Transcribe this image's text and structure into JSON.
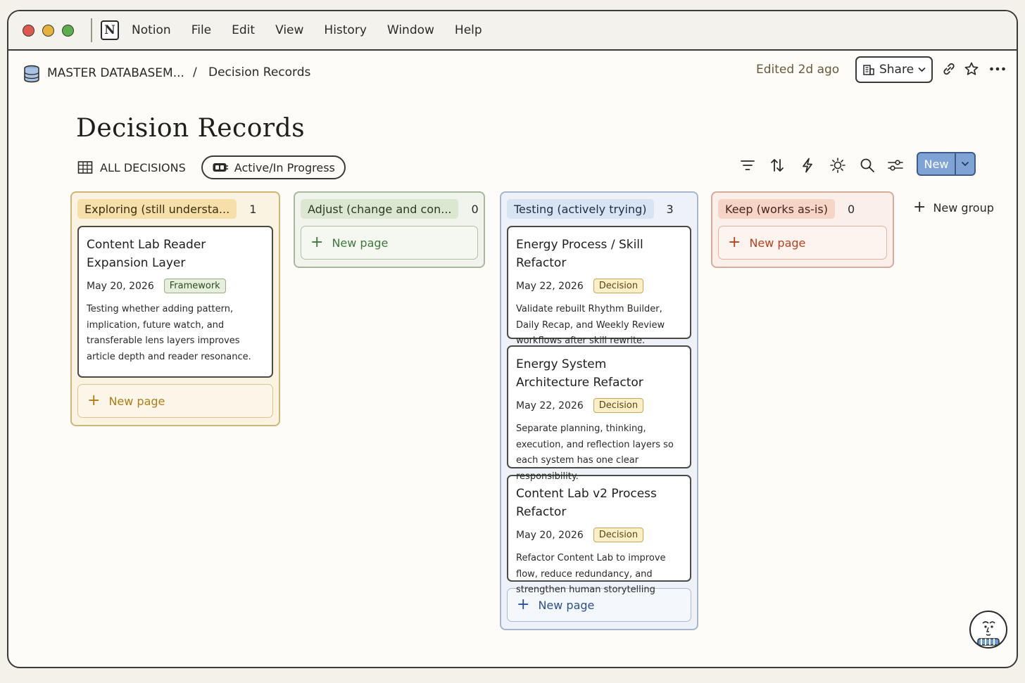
{
  "menubar": {
    "traffic_colors": [
      "#e0574f",
      "#e6b23a",
      "#5bb04d"
    ],
    "app_name": "Notion",
    "items": [
      "File",
      "Edit",
      "View",
      "History",
      "Window",
      "Help"
    ]
  },
  "breadcrumb": {
    "database": "MASTER DATABASEM...",
    "separator": "/",
    "page": "Decision Records"
  },
  "topbar": {
    "edited": "Edited 2d ago",
    "share_label": "Share"
  },
  "page": {
    "title": "Decision Records"
  },
  "views": {
    "all_label": "ALL DECISIONS",
    "active_view": "Active/In Progress"
  },
  "toolbar": {
    "new_label": "New"
  },
  "columns": [
    {
      "name": "Exploring (still understa...",
      "count": "1",
      "accent": "#d9a63a",
      "cards": [
        {
          "title": "Content Lab Reader Expansion Layer",
          "date": "May 20, 2026",
          "tag": "Framework",
          "desc": "Testing whether adding pattern, implication, future watch, and transferable lens layers improves article depth and reader resonance."
        }
      ],
      "new_page": "New page"
    },
    {
      "name": "Adjust (change and con...",
      "count": "0",
      "accent": "#8fae7c",
      "cards": [],
      "new_page": "New page"
    },
    {
      "name": "Testing (actively trying)",
      "count": "3",
      "accent": "#7f9fcc",
      "cards": [
        {
          "title": "Energy Process / Skill Refactor",
          "date": "May 22, 2026",
          "tag": "Decision",
          "desc": "Validate rebuilt Rhythm Builder, Daily Recap, and Weekly Review workflows after skill rewrite."
        },
        {
          "title": "Energy System Architecture Refactor",
          "date": "May 22, 2026",
          "tag": "Decision",
          "desc": "Separate planning, thinking, execution, and reflection layers so each system has one clear responsibility."
        },
        {
          "title": "Content Lab v2 Process Refactor",
          "date": "May 20, 2026",
          "tag": "Decision",
          "desc": "Refactor Content Lab to improve flow, reduce redundancy, and strengthen human storytelling"
        }
      ],
      "new_page": "New page"
    },
    {
      "name": "Keep (works as-is)",
      "count": "0",
      "accent": "#e08c72",
      "cards": [],
      "new_page": "New page"
    }
  ],
  "new_group_label": "New group"
}
